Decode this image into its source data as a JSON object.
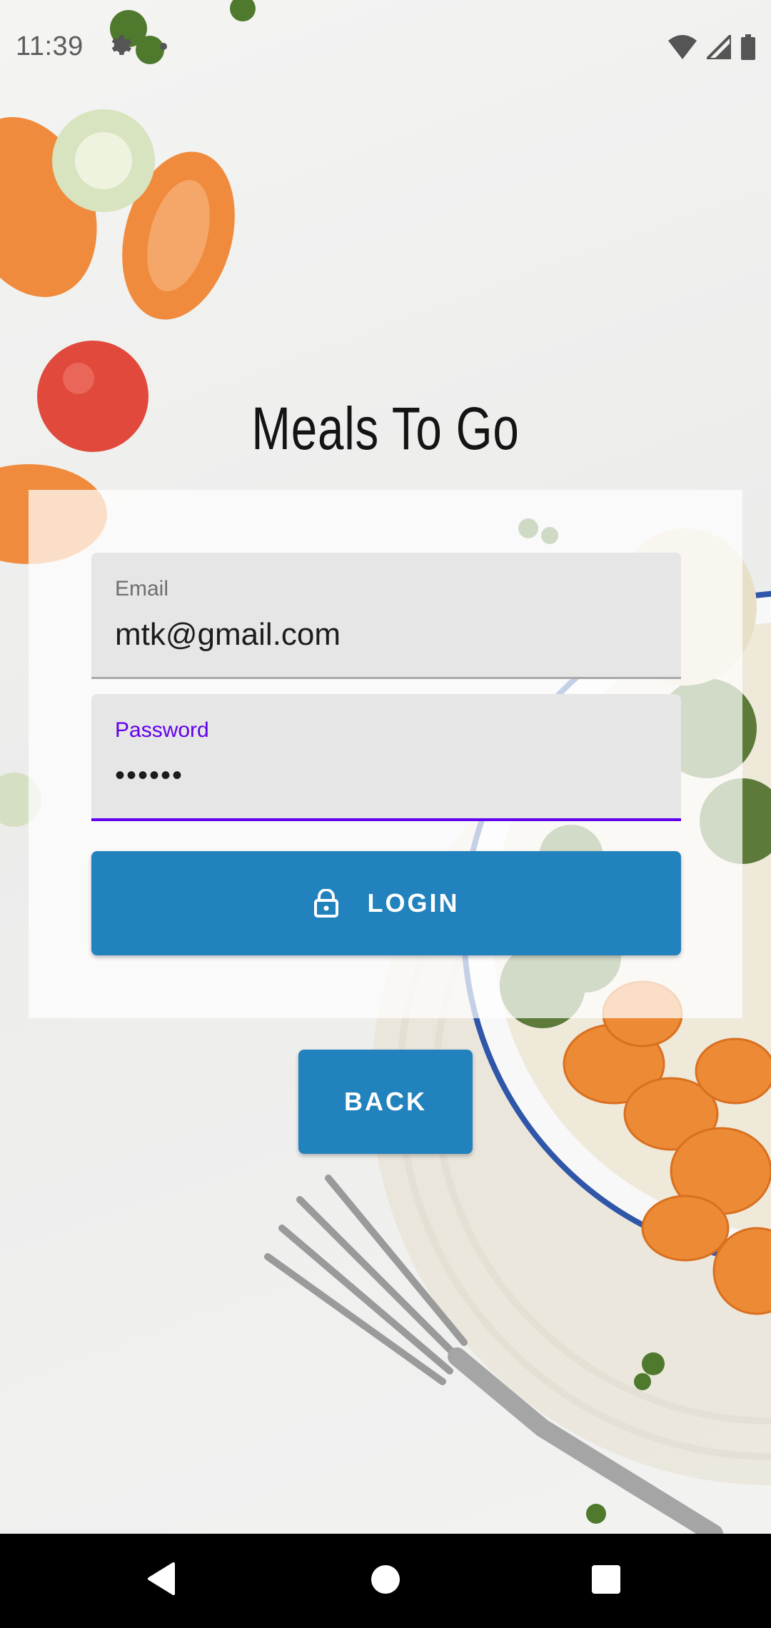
{
  "status_bar": {
    "time": "11:39",
    "icons": [
      "gear-icon",
      "notification-dot",
      "wifi-icon",
      "signal-icon",
      "battery-icon"
    ]
  },
  "app": {
    "title": "Meals To Go"
  },
  "login_form": {
    "email": {
      "label": "Email",
      "value": "mtk@gmail.com"
    },
    "password": {
      "label": "Password",
      "value": "••••••"
    },
    "login_button": {
      "label": "LOGIN",
      "icon": "lock-icon"
    }
  },
  "back_button": {
    "label": "BACK"
  },
  "nav_bar": {
    "icons": [
      "back-triangle-icon",
      "home-circle-icon",
      "recents-square-icon"
    ]
  },
  "colors": {
    "accent": "#6200ee",
    "button": "#2182bd",
    "field_background": "#e6e6e6",
    "navbar": "#000000"
  }
}
